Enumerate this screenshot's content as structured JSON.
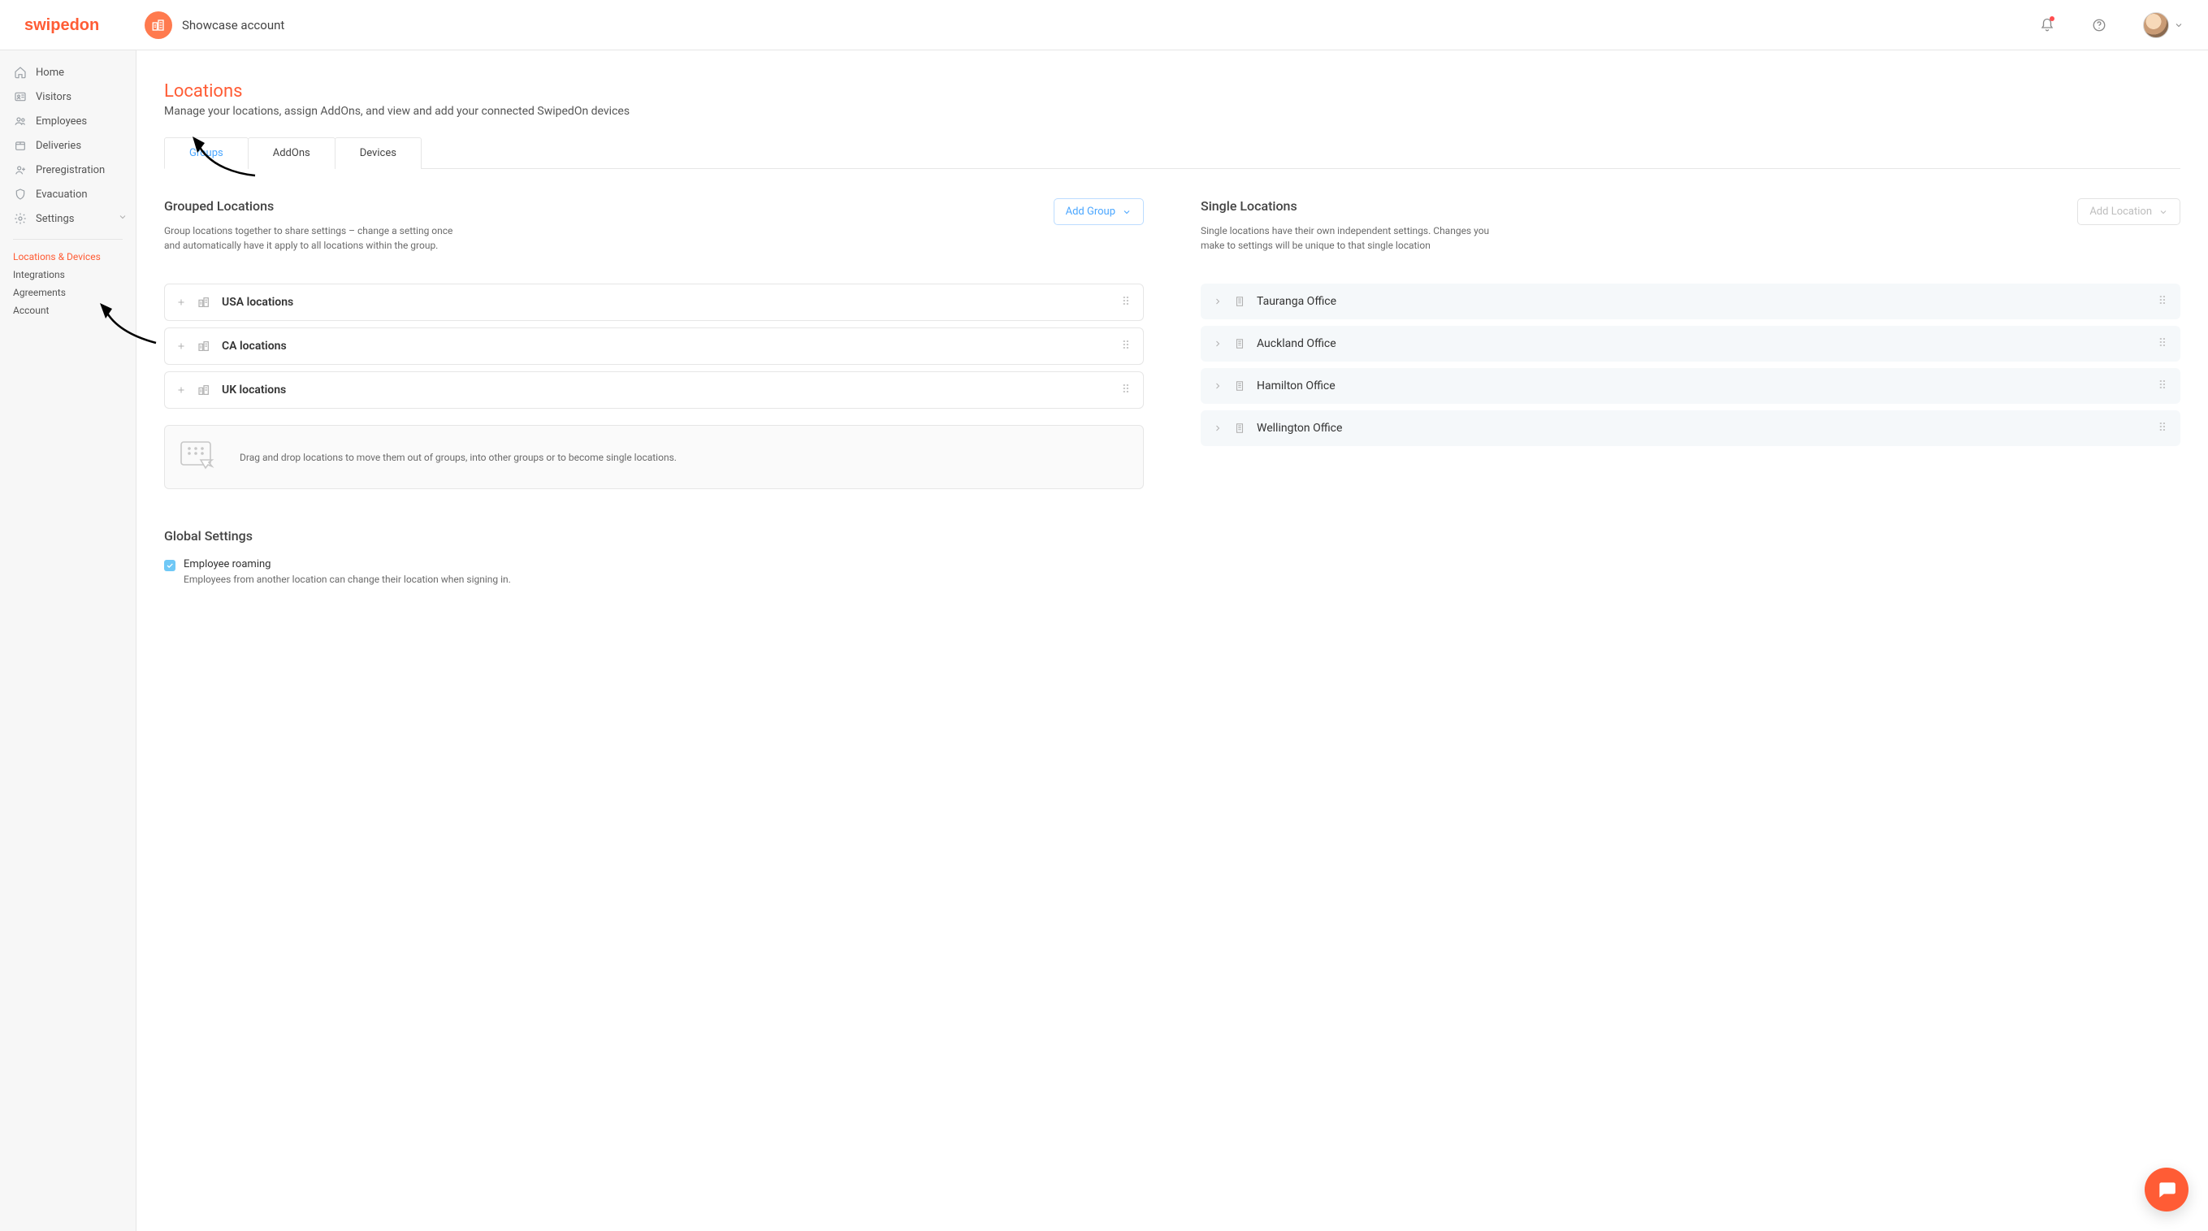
{
  "header": {
    "logo_text": "swipedon",
    "account_label": "Showcase account"
  },
  "sidebar": {
    "items": [
      {
        "label": "Home"
      },
      {
        "label": "Visitors"
      },
      {
        "label": "Employees"
      },
      {
        "label": "Deliveries"
      },
      {
        "label": "Preregistration"
      },
      {
        "label": "Evacuation"
      },
      {
        "label": "Settings"
      }
    ],
    "sub": [
      {
        "label": "Locations & Devices",
        "active": true
      },
      {
        "label": "Integrations"
      },
      {
        "label": "Agreements"
      },
      {
        "label": "Account"
      }
    ]
  },
  "page": {
    "title": "Locations",
    "subtitle": "Manage your locations, assign AddOns, and view and add your connected SwipedOn devices"
  },
  "tabs": [
    {
      "label": "Groups",
      "active": true
    },
    {
      "label": "AddOns"
    },
    {
      "label": "Devices"
    }
  ],
  "grouped": {
    "title": "Grouped Locations",
    "desc": "Group locations together to share settings – change a setting once and automatically have it apply to all locations within the group.",
    "add_btn": "Add Group",
    "groups": [
      {
        "name": "USA locations"
      },
      {
        "name": "CA locations"
      },
      {
        "name": "UK locations"
      }
    ],
    "hint": "Drag and drop locations to move them out of groups, into other groups or to become single locations."
  },
  "single": {
    "title": "Single Locations",
    "desc": "Single locations have their own independent settings. Changes you make to settings will be unique to that single location",
    "add_btn": "Add Location",
    "locations": [
      {
        "name": "Tauranga Office"
      },
      {
        "name": "Auckland Office"
      },
      {
        "name": "Hamilton Office"
      },
      {
        "name": "Wellington Office"
      }
    ]
  },
  "global": {
    "title": "Global Settings",
    "roaming_label": "Employee roaming",
    "roaming_desc": "Employees from another location can change their location when signing in."
  }
}
